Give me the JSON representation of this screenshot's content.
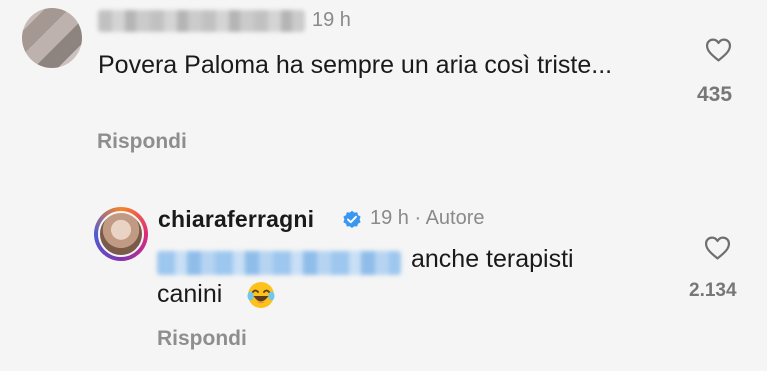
{
  "comment1": {
    "time": "19 h",
    "text": "Povera Paloma ha sempre un aria così triste...",
    "reply_label": "Rispondi",
    "likes": "435"
  },
  "comment2": {
    "username": "chiaraferragni",
    "meta": "19 h · Autore",
    "text_after_mention": "anche terapisti",
    "text_line2": "canini",
    "emoji": "face-with-tears-of-joy",
    "reply_label": "Rispondi",
    "likes": "2.134"
  },
  "colors": {
    "background": "#f5f5f5",
    "text": "#1a1a1a",
    "muted": "#8a8a8a",
    "verified": "#3897f0",
    "mention": "#9ec7ef"
  }
}
